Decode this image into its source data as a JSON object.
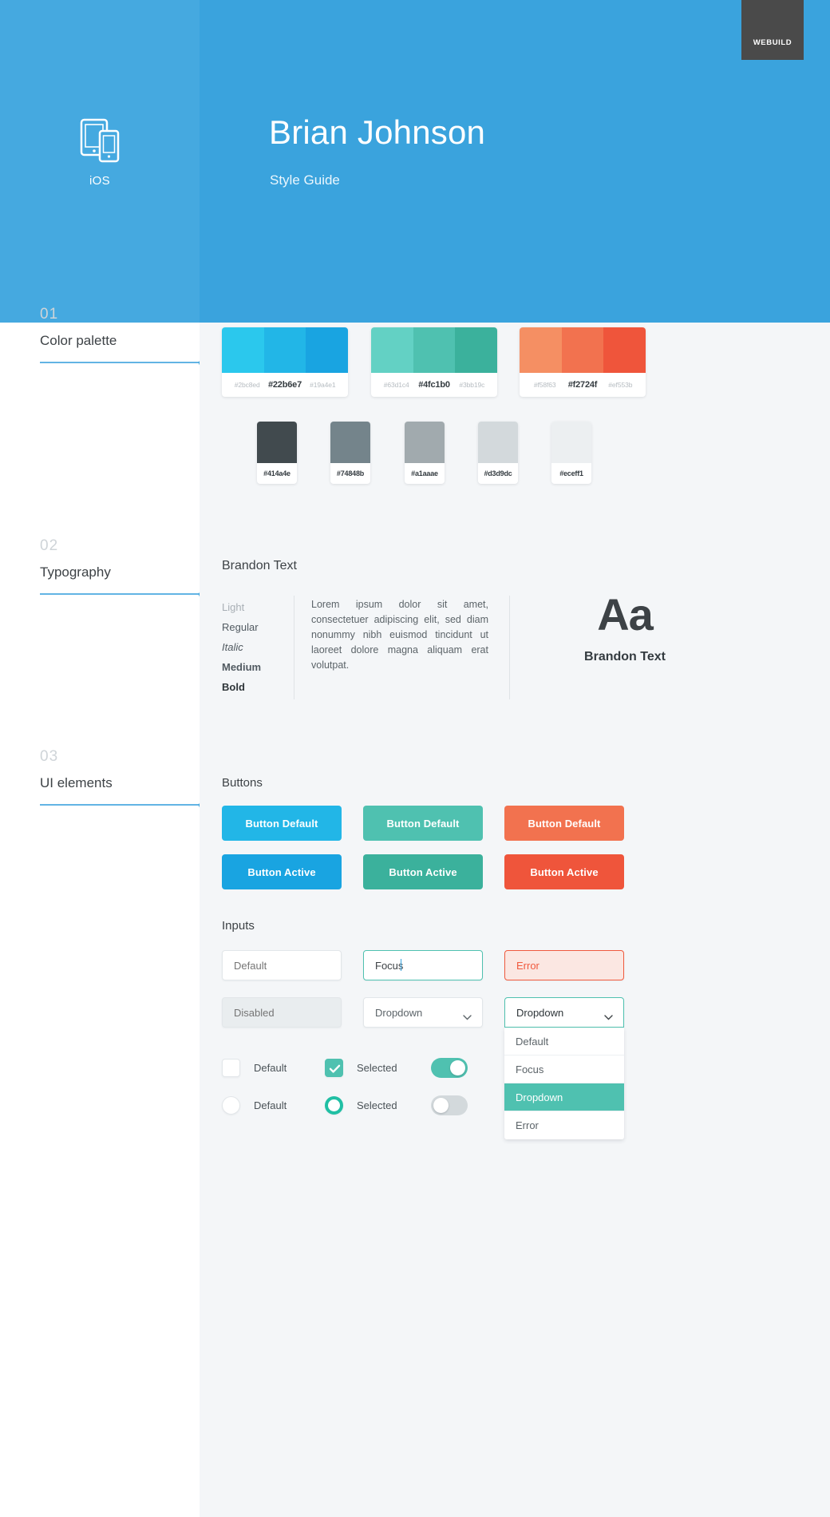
{
  "header": {
    "platform_icon": "tablet-phone-icon",
    "platform_label": "iOS",
    "title": "Brian Johnson",
    "subtitle": "Style Guide",
    "badge": "WEBUILD",
    "bg_color": "#3aa3dd",
    "badge_color": "#4a4a4a"
  },
  "nav": {
    "items": [
      {
        "number": "01",
        "title": "Color palette"
      },
      {
        "number": "02",
        "title": "Typography"
      },
      {
        "number": "03",
        "title": "UI elements"
      }
    ],
    "accent": "#3aa3dd"
  },
  "palette": {
    "groups": [
      {
        "name": "blue",
        "colors": [
          "#2bc8ed",
          "#22b6e7",
          "#19a4e1"
        ],
        "labels": [
          "#2bc8ed",
          "#22b6e7",
          "#19a4e1"
        ],
        "primary_index": 1
      },
      {
        "name": "green",
        "colors": [
          "#63d1c4",
          "#4fc1b0",
          "#3bb19c"
        ],
        "labels": [
          "#63d1c4",
          "#4fc1b0",
          "#3bb19c"
        ],
        "primary_index": 1
      },
      {
        "name": "orange",
        "colors": [
          "#f58f63",
          "#f2724f",
          "#ef553b"
        ],
        "labels": [
          "#f58f63",
          "#f2724f",
          "#ef553b"
        ],
        "primary_index": 1
      }
    ],
    "grays": [
      {
        "color": "#414a4e",
        "label": "#414a4e"
      },
      {
        "color": "#74848b",
        "label": "#74848b"
      },
      {
        "color": "#a1aaae",
        "label": "#a1aaae"
      },
      {
        "color": "#d3d9dc",
        "label": "#d3d9dc"
      },
      {
        "color": "#eceff1",
        "label": "#eceff1"
      }
    ]
  },
  "typography": {
    "family": "Brandon Text",
    "weights": [
      "Light",
      "Regular",
      "Italic",
      "Medium",
      "Bold"
    ],
    "sample": "Lorem ipsum dolor sit amet, consectetuer adipiscing elit, sed diam nonummy nibh euismod tincidunt ut laoreet dolore magna aliquam erat volutpat.",
    "specimen_glyph": "Aa",
    "specimen_name": "Brandon Text"
  },
  "ui": {
    "buttons_heading": "Buttons",
    "buttons": [
      {
        "label": "Button Default",
        "color": "#22b6e7",
        "state": "default"
      },
      {
        "label": "Button Default",
        "color": "#4fc1b0",
        "state": "default"
      },
      {
        "label": "Button Default",
        "color": "#f2724f",
        "state": "default"
      },
      {
        "label": "Button Active",
        "color": "#19a4e1",
        "state": "active"
      },
      {
        "label": "Button Active",
        "color": "#3bb19c",
        "state": "active"
      },
      {
        "label": "Button Active",
        "color": "#ef553b",
        "state": "active"
      }
    ],
    "inputs_heading": "Inputs",
    "inputs": {
      "default_placeholder": "Default",
      "focus_value": "Focus",
      "error_value": "Error",
      "disabled_placeholder": "Disabled"
    },
    "dropdown_closed": {
      "value": "Dropdown",
      "icon": "chevron-down-icon"
    },
    "dropdown_open": {
      "value": "Dropdown",
      "icon": "chevron-down-icon",
      "options": [
        "Default",
        "Focus",
        "Dropdown",
        "Error"
      ],
      "selected_index": 2
    },
    "checkbox_default_label": "Default",
    "checkbox_selected_label": "Selected",
    "radio_default_label": "Default",
    "radio_selected_label": "Selected",
    "toggle_on_state": "on",
    "toggle_off_state": "off"
  }
}
